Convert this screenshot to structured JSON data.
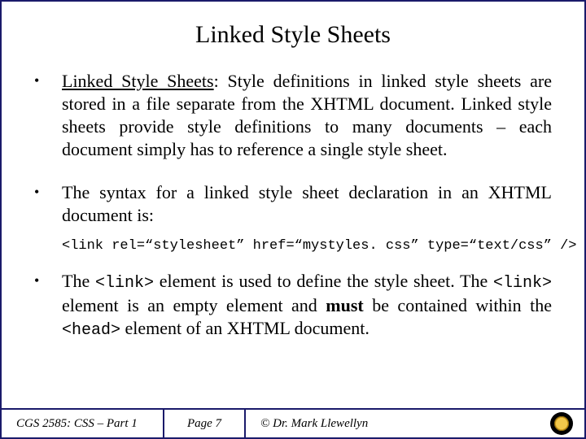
{
  "title": "Linked Style Sheets",
  "bullets": {
    "b1": {
      "term": "Linked Style Sheets",
      "text": ": Style definitions in linked style sheets are stored in a file separate from the XHTML document. Linked style sheets provide style definitions to many documents – each document simply has to reference a single style sheet."
    },
    "b2": {
      "text": "The syntax for a linked style sheet declaration in an XHTML document is:"
    },
    "code": "<link rel=“stylesheet” href=“mystyles. css” type=“text/css” />",
    "b3": {
      "pre1": "The ",
      "code1": "<link>",
      "mid1": " element is used to define the style sheet.  The ",
      "code2": "<link>",
      "mid2": " element is an empty element and ",
      "bold": "must",
      "mid3": " be contained within the ",
      "code3": "<head>",
      "post": " element of an XHTML document."
    }
  },
  "footer": {
    "course": "CGS 2585: CSS – Part 1",
    "page": "Page 7",
    "copyright": "© Dr. Mark Llewellyn"
  }
}
